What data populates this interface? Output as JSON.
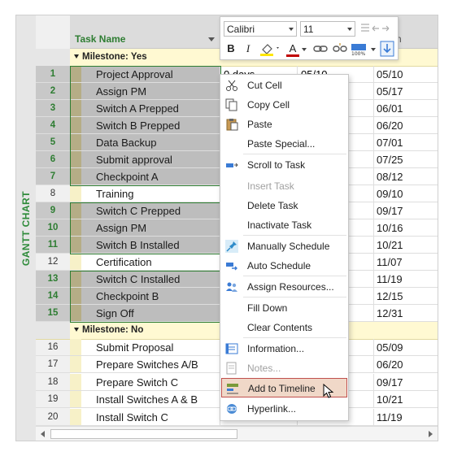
{
  "side_label": "GANTT CHART",
  "header": {
    "task_name": "Task Name",
    "finish_col": "h"
  },
  "groups": [
    {
      "label": "Milestone: Yes"
    },
    {
      "label": "Milestone: No"
    }
  ],
  "rows": [
    {
      "num": "1",
      "name": "Project Approval",
      "dur": "0 days",
      "start": "05/10",
      "finish": "05/10"
    },
    {
      "num": "2",
      "name": "Assign PM",
      "dur": "",
      "start": "",
      "finish": "05/17"
    },
    {
      "num": "3",
      "name": "Switch A Prepped",
      "dur": "",
      "start": "",
      "finish": "06/01"
    },
    {
      "num": "4",
      "name": "Switch B Prepped",
      "dur": "",
      "start": "",
      "finish": "06/20"
    },
    {
      "num": "5",
      "name": "Data Backup",
      "dur": "",
      "start": "",
      "finish": "07/01"
    },
    {
      "num": "6",
      "name": "Submit approval",
      "dur": "",
      "start": "",
      "finish": "07/25"
    },
    {
      "num": "7",
      "name": "Checkpoint A",
      "dur": "",
      "start": "",
      "finish": "08/12"
    },
    {
      "num": "8",
      "name": "Training",
      "dur": "",
      "start": "",
      "finish": "09/10"
    },
    {
      "num": "9",
      "name": "Switch C Prepped",
      "dur": "",
      "start": "",
      "finish": "09/17"
    },
    {
      "num": "10",
      "name": "Assign PM",
      "dur": "",
      "start": "",
      "finish": "10/16"
    },
    {
      "num": "11",
      "name": "Switch B Installed",
      "dur": "",
      "start": "",
      "finish": "10/21"
    },
    {
      "num": "12",
      "name": "Certification",
      "dur": "",
      "start": "",
      "finish": "11/07"
    },
    {
      "num": "13",
      "name": "Switch C Installed",
      "dur": "",
      "start": "",
      "finish": "11/19"
    },
    {
      "num": "14",
      "name": "Checkpoint B",
      "dur": "",
      "start": "",
      "finish": "12/15"
    },
    {
      "num": "15",
      "name": "Sign Off",
      "dur": "",
      "start": "",
      "finish": "12/31"
    },
    {
      "num": "16",
      "name": "Submit Proposal",
      "dur": "",
      "start": "",
      "finish": "05/09"
    },
    {
      "num": "17",
      "name": "Prepare Switches A/B",
      "dur": "",
      "start": "",
      "finish": "06/20"
    },
    {
      "num": "18",
      "name": "Prepare Switch C",
      "dur": "",
      "start": "",
      "finish": "09/17"
    },
    {
      "num": "19",
      "name": "Install Switches A & B",
      "dur": "",
      "start": "",
      "finish": "10/21"
    },
    {
      "num": "20",
      "name": "Install Switch C",
      "dur": "",
      "start": "",
      "finish": "11/19"
    }
  ],
  "mini_toolbar": {
    "font": "Calibri",
    "size": "11",
    "bold": "B",
    "italic": "I",
    "font_color_letter": "A",
    "fill_color": "#ffe600",
    "font_color": "#c00000"
  },
  "context_menu": [
    {
      "label": "Cut Cell",
      "icon": "scissors-icon",
      "disabled": false
    },
    {
      "label": "Copy Cell",
      "icon": "copy-icon",
      "disabled": false
    },
    {
      "label": "Paste",
      "icon": "clipboard-icon",
      "disabled": false
    },
    {
      "label": "Paste Special...",
      "icon": "",
      "disabled": false
    },
    {
      "label": "Scroll to Task",
      "icon": "scroll-task-icon",
      "disabled": false
    },
    {
      "label": "Insert Task",
      "icon": "",
      "disabled": true
    },
    {
      "label": "Delete Task",
      "icon": "",
      "disabled": false
    },
    {
      "label": "Inactivate Task",
      "icon": "",
      "disabled": false
    },
    {
      "label": "Manually Schedule",
      "icon": "pushpin-icon",
      "disabled": false
    },
    {
      "label": "Auto Schedule",
      "icon": "auto-schedule-icon",
      "disabled": false
    },
    {
      "label": "Assign Resources...",
      "icon": "people-icon",
      "disabled": false
    },
    {
      "label": "Fill Down",
      "icon": "",
      "disabled": false
    },
    {
      "label": "Clear Contents",
      "icon": "",
      "disabled": false
    },
    {
      "label": "Information...",
      "icon": "information-icon",
      "disabled": false
    },
    {
      "label": "Notes...",
      "icon": "notes-icon",
      "disabled": true
    },
    {
      "label": "Add to Timeline",
      "icon": "timeline-icon",
      "disabled": false,
      "highlighted": true
    },
    {
      "label": "Hyperlink...",
      "icon": "hyperlink-icon",
      "disabled": false
    }
  ],
  "colors": {
    "accent_green": "#2e7d32",
    "group_bg": "#fff9d2",
    "highlight_border": "#c0504d",
    "highlight_bg": "#f0d8c8"
  }
}
